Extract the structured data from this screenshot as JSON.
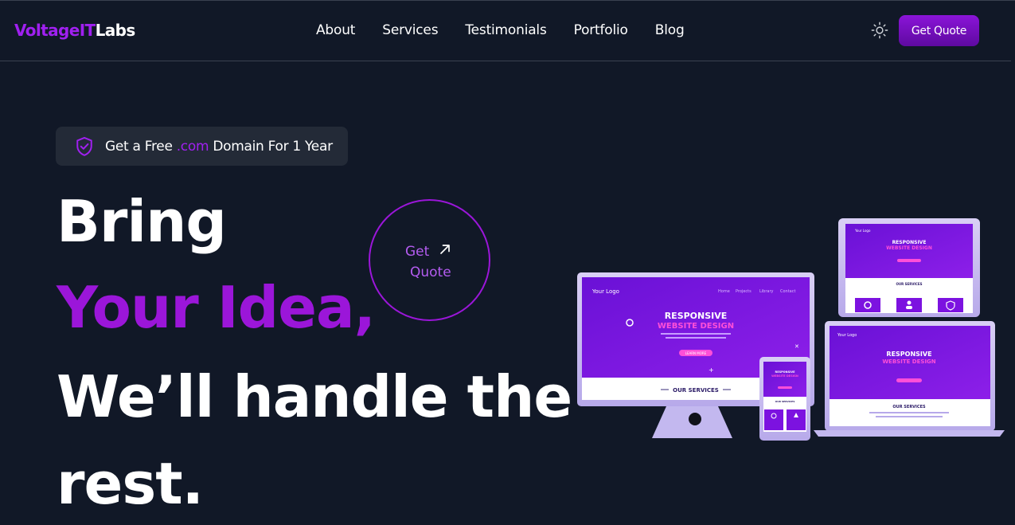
{
  "nav": {
    "logo_part1": "VoltageIT",
    "logo_part2": "Labs",
    "links": [
      "About",
      "Services",
      "Testimonials",
      "Portfolio",
      "Blog"
    ],
    "theme_toggle_icon": "sun-icon",
    "cta_label": "Get Quote"
  },
  "promo": {
    "icon": "shield-check-icon",
    "text_before": "Get a Free ",
    "text_accent": ".com",
    "text_after": " Domain For 1 Year"
  },
  "hero": {
    "line1": "Bring",
    "line2": "Your Idea,",
    "line3": "We’ll handle the",
    "line4": "rest.",
    "circle_cta_line1": "Get",
    "circle_cta_line2": "Quote",
    "circle_cta_icon": "arrow-up-right-icon"
  },
  "illustration": {
    "monitor": {
      "brand": "Your Logo",
      "nav": [
        "Home",
        "Projects",
        "Library",
        "Contact"
      ],
      "heading1": "RESPONSIVE",
      "heading2": "WEBSITE DESIGN",
      "button": "LEARN MORE",
      "section": "OUR SERVICES"
    },
    "tablet": {
      "brand": "Your Logo",
      "heading1": "RESPONSIVE",
      "heading2": "WEBSITE DESIGN",
      "section": "OUR SERVICES"
    },
    "laptop": {
      "brand": "Your Logo",
      "heading1": "RESPONSIVE",
      "heading2": "WEBSITE DESIGN",
      "section": "OUR SERVICES"
    },
    "phone": {
      "heading1": "RESPONSIVE",
      "heading2": "WEBSITE DESIGN",
      "section": "OUR SERVICES"
    }
  },
  "colors": {
    "background": "#111827",
    "accent": "#9b16d9",
    "promo_bg": "#232a37"
  }
}
